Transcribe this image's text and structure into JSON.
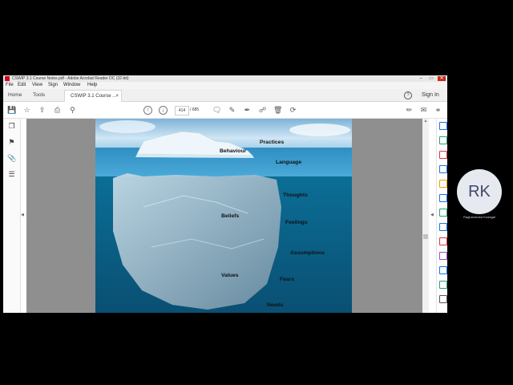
{
  "window": {
    "title": "CSWIP 3.1 Course Notes.pdf - Adobe Acrobat Reader DC (32-bit)",
    "controls": {
      "minimize": "–",
      "maximize": "▭",
      "close": "✕"
    }
  },
  "menu": {
    "items": [
      "File",
      "Edit",
      "View",
      "Sign",
      "Window",
      "Help"
    ]
  },
  "tabs": {
    "home": "Home",
    "tools": "Tools",
    "document": "CSWIP 3.1 Course ...",
    "close": "×",
    "help": "?",
    "sign_in": "Sign In"
  },
  "toolbar": {
    "icons": {
      "save": "save-icon",
      "bookmark": "star-icon",
      "upload": "upload-icon",
      "print": "print-icon",
      "zoom": "magnifier-icon",
      "prev": "arrow-up-icon",
      "next": "arrow-down-icon",
      "comment": "comment-icon",
      "pen": "pen-icon",
      "sign": "sign-icon",
      "stamp": "stamp-icon",
      "delete": "trash-icon",
      "rotate": "rotate-icon",
      "edit": "edit-icon",
      "mail": "mail-icon",
      "share": "share-icon"
    },
    "page_current": "414",
    "page_total": "/ 685"
  },
  "sidebar": {
    "icons": [
      "pages-icon",
      "bookmark-icon",
      "attachment-icon",
      "layers-icon"
    ]
  },
  "right_tools": {
    "colors": [
      "#1473e6",
      "#2d9d78",
      "#d7373f",
      "#1473e6",
      "#e8a400",
      "#1473e6",
      "#2d9d78",
      "#1473e6",
      "#d7373f",
      "#9b4dca",
      "#1473e6",
      "#2d9d78",
      "#555555"
    ]
  },
  "iceberg": {
    "above": {
      "left": "Behaviour",
      "right": [
        "Practices",
        "Language"
      ]
    },
    "below": {
      "left": [
        "Beliefs",
        "Values"
      ],
      "right": [
        "Thoughts",
        "Feelings",
        "Assumptions",
        "Fears",
        "Needs"
      ]
    }
  },
  "participant": {
    "initials": "RK",
    "name": "Raghavendra Kodagal"
  }
}
